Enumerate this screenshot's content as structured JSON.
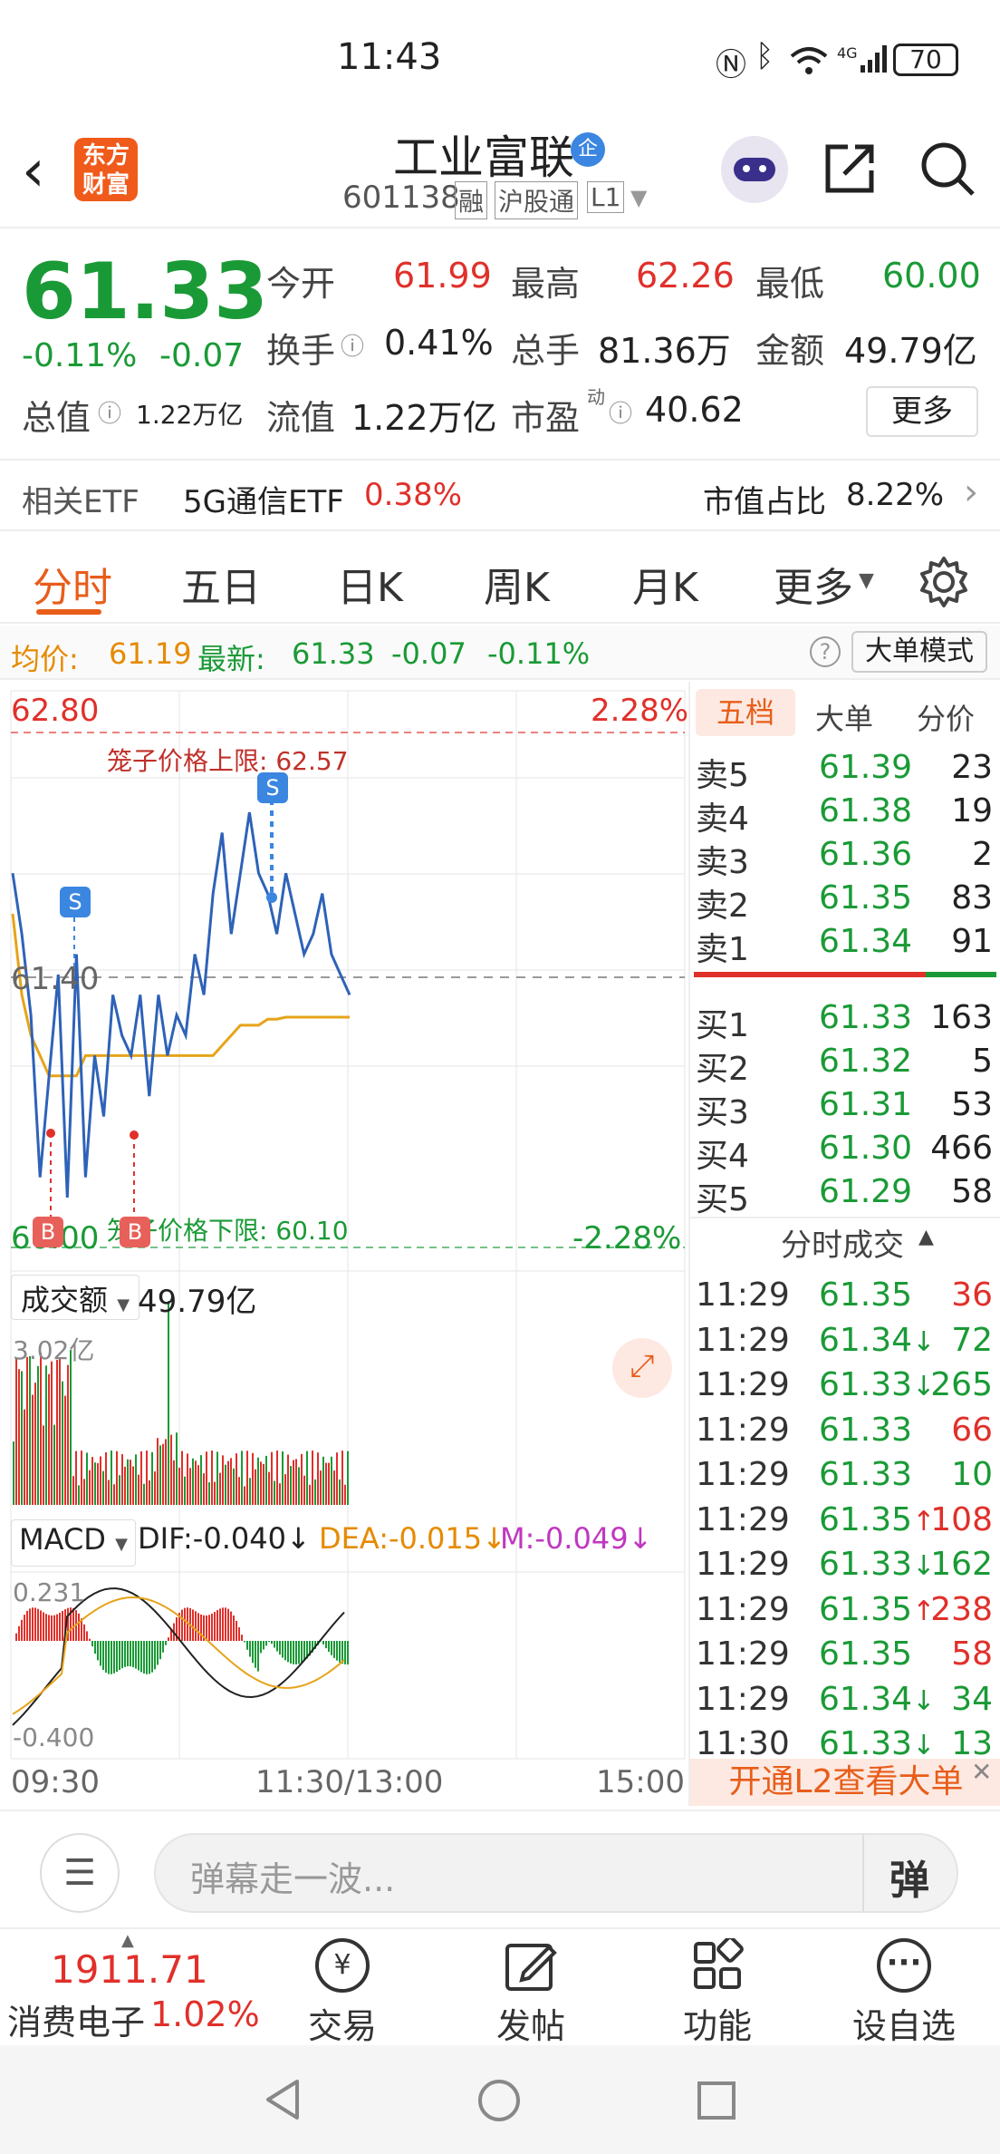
{
  "status": {
    "time": "11:43",
    "battery": "70"
  },
  "header": {
    "logo_text": "东方财富",
    "title": "工业富联",
    "title_badge": "企",
    "code": "601138",
    "tags": [
      "融",
      "沪股通",
      "L1"
    ]
  },
  "quote": {
    "price": "61.33",
    "change_pct": "-0.11%",
    "change": "-0.07",
    "open_label": "今开",
    "open": "61.99",
    "high_label": "最高",
    "high": "62.26",
    "low_label": "最低",
    "low": "60.00",
    "turnover_label": "换手",
    "turnover": "0.41%",
    "volume_label": "总手",
    "volume": "81.36万",
    "amount_label": "金额",
    "amount": "49.79亿",
    "mktcap_label": "总值",
    "mktcap": "1.22万亿",
    "float_label": "流值",
    "float": "1.22万亿",
    "pe_label": "市盈",
    "pe_sup": "动",
    "pe": "40.62",
    "more_button": "更多"
  },
  "etf": {
    "label": "相关ETF",
    "name": "5G通信ETF",
    "pct": "0.38%",
    "share_label": "市值占比",
    "share": "8.22%"
  },
  "tabs": [
    "分时",
    "五日",
    "日K",
    "周K",
    "月K",
    "更多"
  ],
  "active_tab": "分时",
  "avgline": {
    "avg_label": "均价:",
    "avg": "61.19",
    "latest_label": "最新:",
    "latest": "61.33",
    "chg": "-0.07",
    "chg_pct": "-0.11%",
    "mode_button": "大单模式"
  },
  "chart": {
    "price_top": "62.80",
    "pct_top": "2.28%",
    "price_bottom": "60.00",
    "pct_bottom": "-2.28%",
    "mid_price": "61.40",
    "limit_up_label": "笼子价格上限:",
    "limit_up": "62.57",
    "limit_down_label": "笼子价格下限:",
    "limit_down": "60.10",
    "volume_selector": "成交额",
    "volume_total": "49.79亿",
    "volume_max": "3.02亿",
    "macd_selector": "MACD",
    "dif": "DIF:-0.040",
    "dea": "DEA:-0.015",
    "m": "M:-0.049",
    "macd_top": "0.231",
    "macd_bottom": "-0.400",
    "time_start": "09:30",
    "time_mid": "11:30/13:00",
    "time_end": "15:00",
    "buy_marker": "B",
    "sell_marker": "S"
  },
  "chart_data": {
    "type": "line",
    "title": "",
    "x_range": [
      "09:30",
      "15:00"
    ],
    "y_range": [
      60.0,
      62.8
    ],
    "series": [
      {
        "name": "price",
        "values": [
          61.9,
          61.6,
          61.2,
          60.4,
          60.9,
          61.4,
          60.3,
          61.5,
          60.4,
          61.0,
          60.7,
          61.3,
          61.1,
          61.0,
          61.3,
          60.8,
          61.3,
          61.0,
          61.2,
          61.1,
          61.5,
          61.3,
          61.8,
          62.1,
          61.6,
          61.9,
          62.2,
          61.9,
          61.8,
          61.6,
          61.9,
          61.7,
          61.5,
          61.6,
          61.8,
          61.5,
          61.4,
          61.3
        ]
      },
      {
        "name": "avg",
        "values": [
          61.7,
          61.3,
          61.1,
          61.0,
          60.9,
          60.9,
          60.9,
          60.9,
          61.0,
          61.0,
          61.0,
          61.0,
          61.0,
          61.0,
          61.0,
          61.0,
          61.0,
          61.0,
          61.0,
          61.0,
          61.0,
          61.0,
          61.0,
          61.05,
          61.1,
          61.15,
          61.15,
          61.15,
          61.18,
          61.18,
          61.19,
          61.19,
          61.19,
          61.19,
          61.19,
          61.19,
          61.19,
          61.19
        ]
      }
    ]
  },
  "orderbook": {
    "tabs": [
      "五档",
      "大单",
      "分价"
    ],
    "asks": [
      {
        "label": "卖5",
        "price": "61.39",
        "vol": "23"
      },
      {
        "label": "卖4",
        "price": "61.38",
        "vol": "19"
      },
      {
        "label": "卖3",
        "price": "61.36",
        "vol": "2"
      },
      {
        "label": "卖2",
        "price": "61.35",
        "vol": "83"
      },
      {
        "label": "卖1",
        "price": "61.34",
        "vol": "91"
      }
    ],
    "bids": [
      {
        "label": "买1",
        "price": "61.33",
        "vol": "163"
      },
      {
        "label": "买2",
        "price": "61.32",
        "vol": "5"
      },
      {
        "label": "买3",
        "price": "61.31",
        "vol": "53"
      },
      {
        "label": "买4",
        "price": "61.30",
        "vol": "466"
      },
      {
        "label": "买5",
        "price": "61.29",
        "vol": "58"
      }
    ],
    "ticks_title": "分时成交",
    "ticks": [
      {
        "time": "11:29",
        "price": "61.35",
        "arrow": "",
        "vol": "36",
        "dir": "up"
      },
      {
        "time": "11:29",
        "price": "61.34",
        "arrow": "↓",
        "vol": "72",
        "dir": "down"
      },
      {
        "time": "11:29",
        "price": "61.33",
        "arrow": "↓",
        "vol": "265",
        "dir": "down"
      },
      {
        "time": "11:29",
        "price": "61.33",
        "arrow": "",
        "vol": "66",
        "dir": "up"
      },
      {
        "time": "11:29",
        "price": "61.33",
        "arrow": "",
        "vol": "10",
        "dir": "down"
      },
      {
        "time": "11:29",
        "price": "61.35",
        "arrow": "↑",
        "vol": "108",
        "dir": "up"
      },
      {
        "time": "11:29",
        "price": "61.33",
        "arrow": "↓",
        "vol": "162",
        "dir": "down"
      },
      {
        "time": "11:29",
        "price": "61.35",
        "arrow": "↑",
        "vol": "238",
        "dir": "up"
      },
      {
        "time": "11:29",
        "price": "61.35",
        "arrow": "",
        "vol": "58",
        "dir": "up"
      },
      {
        "time": "11:29",
        "price": "61.34",
        "arrow": "↓",
        "vol": "34",
        "dir": "down"
      },
      {
        "time": "11:30",
        "price": "61.33",
        "arrow": "↓",
        "vol": "13",
        "dir": "down"
      }
    ],
    "l2_banner": "开通L2查看大单"
  },
  "bottom": {
    "input_placeholder": "弹幕走一波...",
    "danmu_button": "弹",
    "index_value": "1911.71",
    "index_name": "消费电子",
    "index_pct": "1.02%",
    "tab_trade": "交易",
    "tab_post": "发帖",
    "tab_func": "功能",
    "tab_watch": "设自选"
  },
  "colors": {
    "up": "#e0302a",
    "down": "#1a9a36",
    "accent": "#e85d1a",
    "price_line": "#2e62b8",
    "avg_line": "#e6a41a"
  }
}
